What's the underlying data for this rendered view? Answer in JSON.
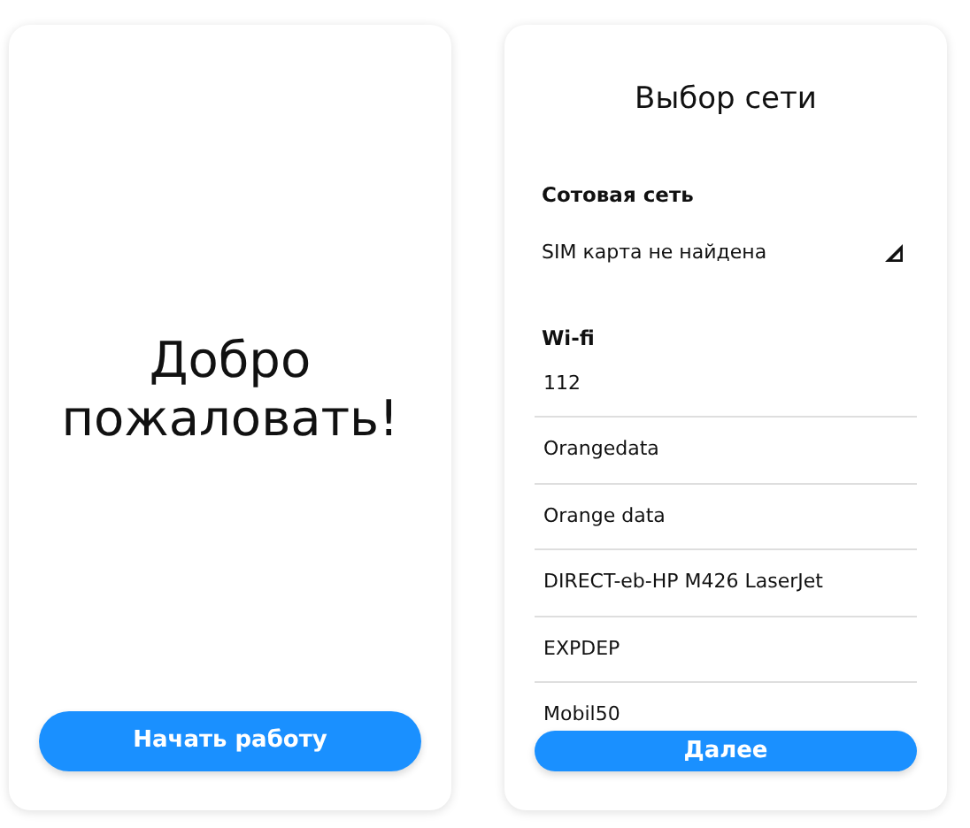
{
  "welcome_screen": {
    "title": "Добро пожаловать!",
    "button": "Начать работу"
  },
  "network_screen": {
    "title": "Выбор сети",
    "cellular": {
      "heading": "Сотовая сеть",
      "status": "SIM карта не найдена"
    },
    "wifi": {
      "heading": "Wi-fi",
      "networks": [
        {
          "name": "112"
        },
        {
          "name": "Orangedata"
        },
        {
          "name": "Orange data"
        },
        {
          "name": "DIRECT-eb-HP M426 LaserJet"
        },
        {
          "name": "EXPDEP"
        },
        {
          "name": "Mobil50"
        }
      ]
    },
    "button": "Далее"
  }
}
